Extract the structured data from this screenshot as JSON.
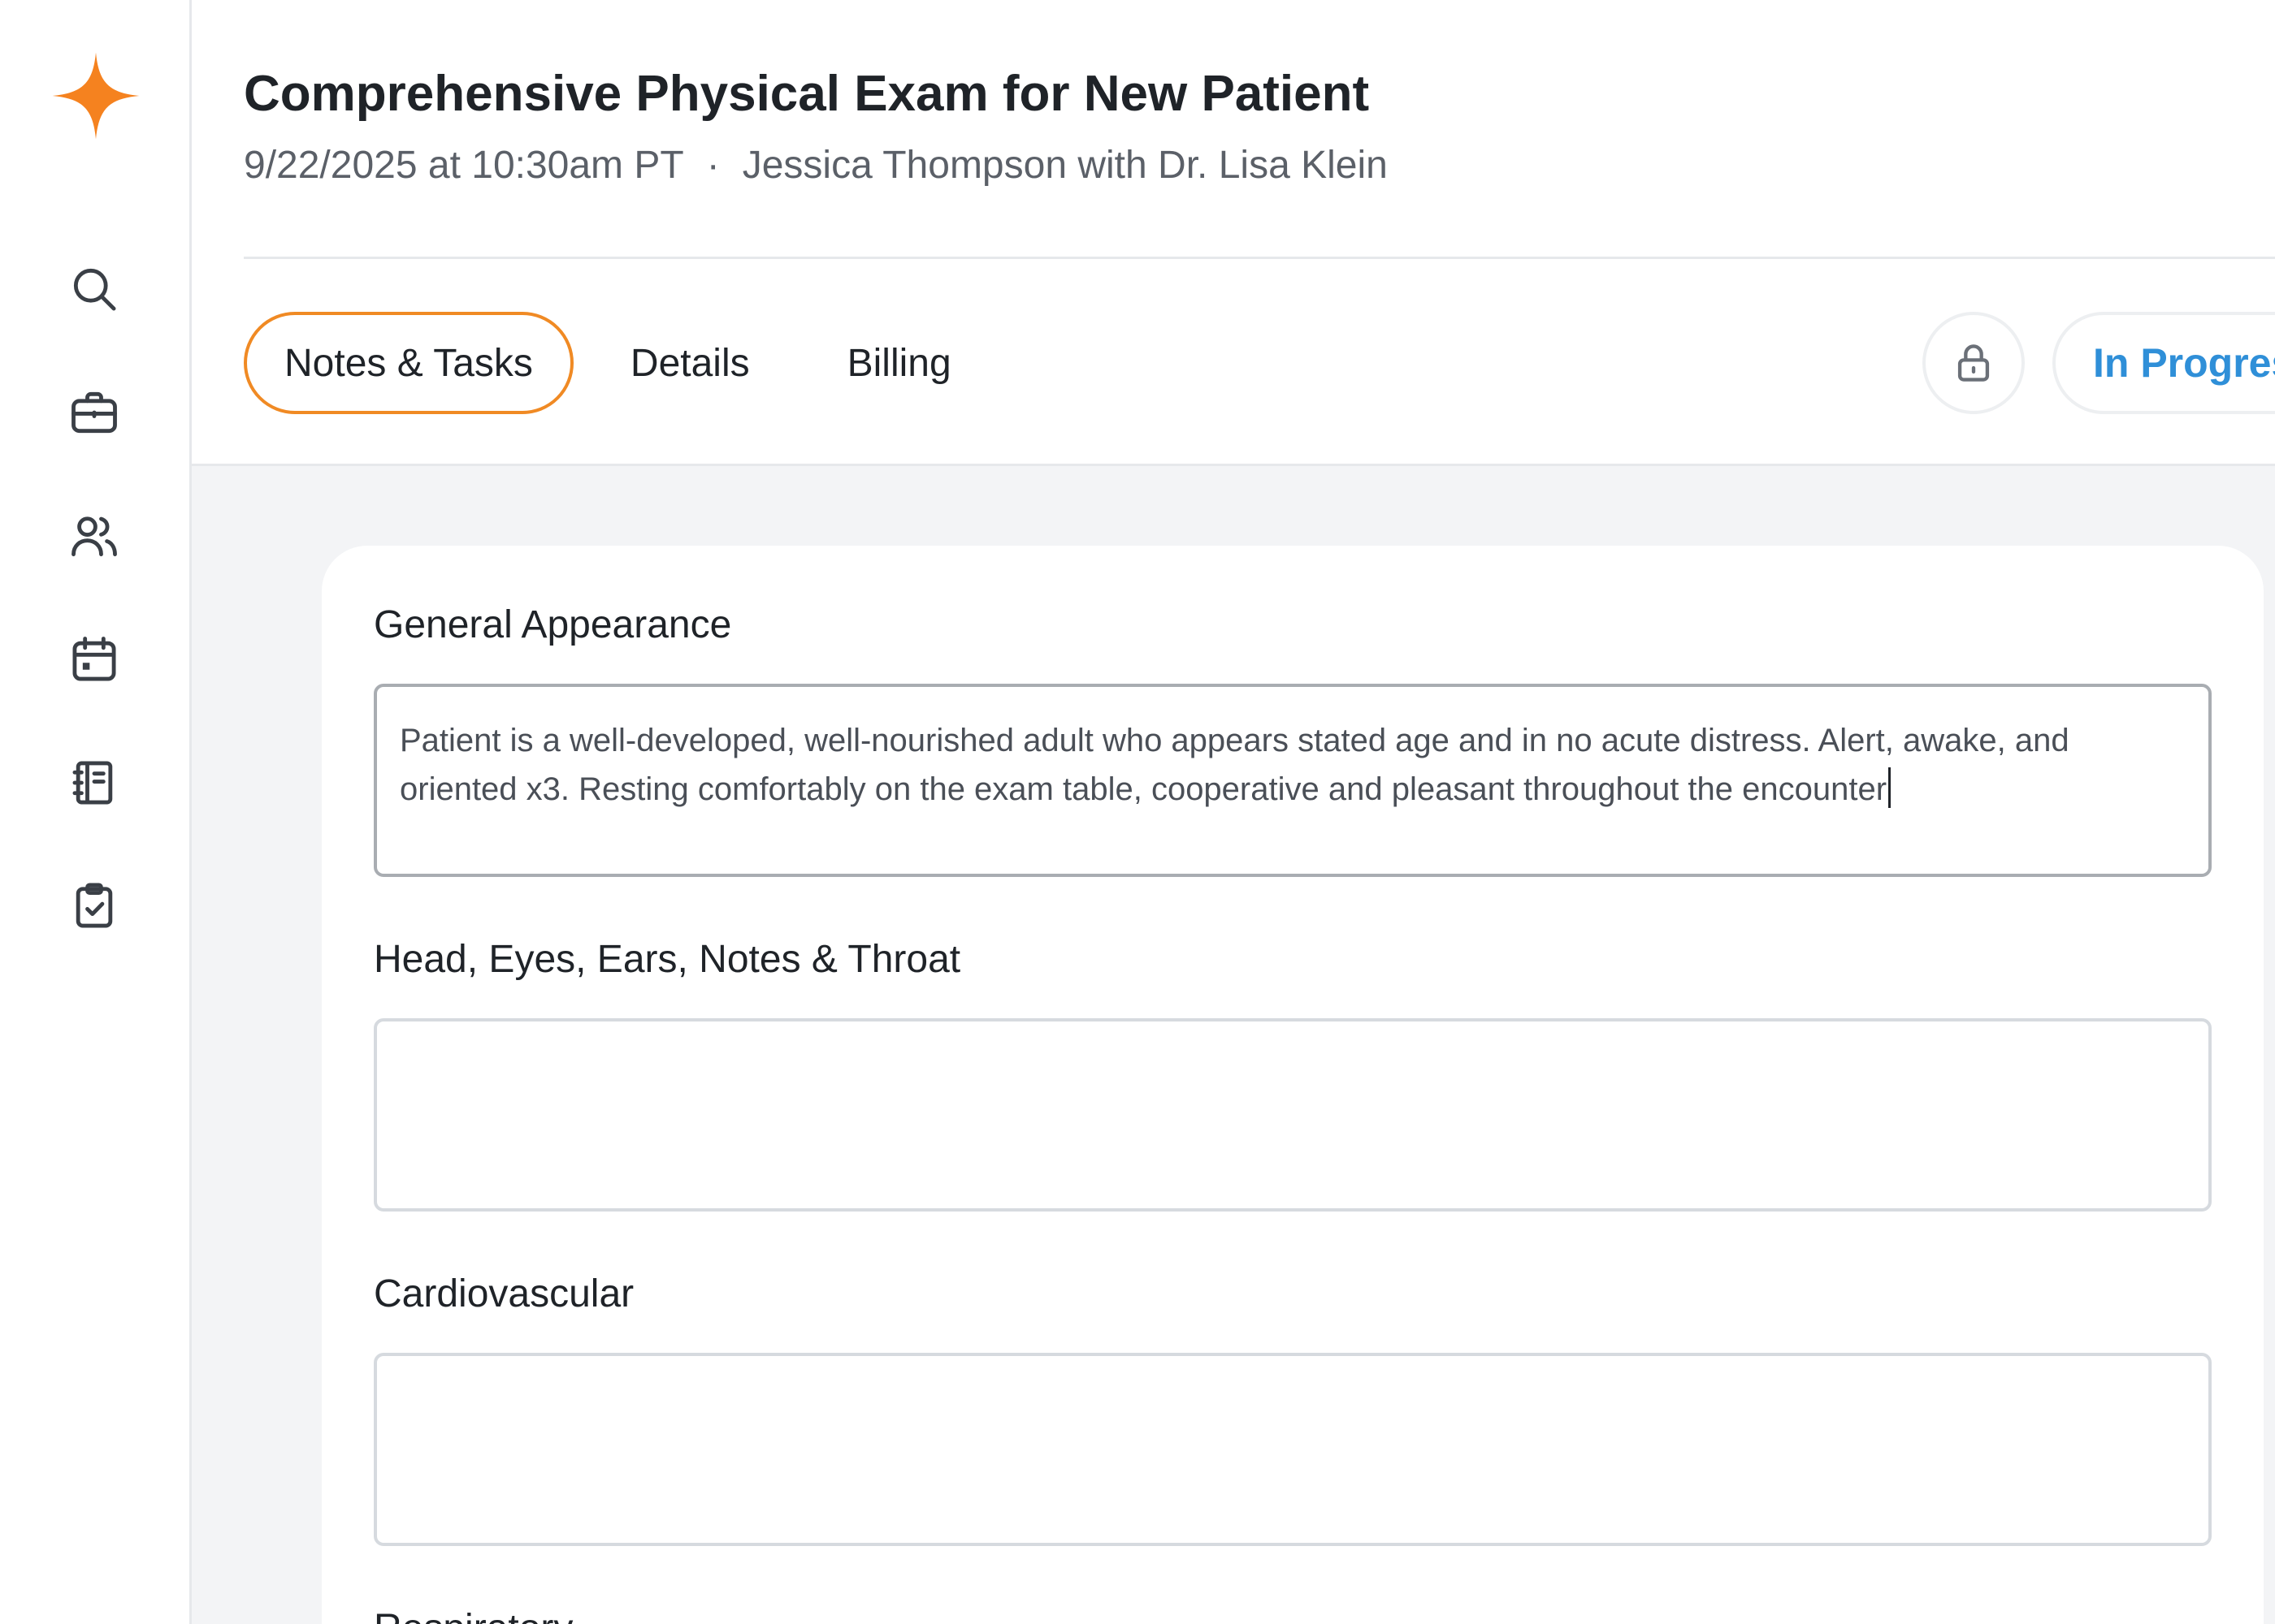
{
  "sidebar": {
    "logo": "sparkle-logo",
    "accent_color": "#f08a24",
    "items": [
      {
        "icon": "search-icon"
      },
      {
        "icon": "briefcase-icon"
      },
      {
        "icon": "users-icon"
      },
      {
        "icon": "calendar-icon"
      },
      {
        "icon": "notebook-icon"
      },
      {
        "icon": "clipboard-check-icon"
      }
    ]
  },
  "header": {
    "title": "Comprehensive Physical Exam for New Patient",
    "datetime": "9/22/2025 at 10:30am PT",
    "separator": "·",
    "participants": "Jessica Thompson with Dr. Lisa Klein"
  },
  "tabs": [
    {
      "label": "Notes & Tasks",
      "active": true
    },
    {
      "label": "Details",
      "active": false
    },
    {
      "label": "Billing",
      "active": false
    }
  ],
  "status": {
    "lock_icon": "lock-icon",
    "label": "In Progress",
    "color": "#2f8fd8"
  },
  "form": {
    "fields": [
      {
        "label": "General Appearance",
        "value": "Patient is a well-developed, well-nourished adult who appears stated age and in no acute distress. Alert, awake, and oriented x3. Resting comfortably on the exam table, cooperative and pleasant throughout the encounter"
      },
      {
        "label": "Head, Eyes, Ears, Notes & Throat",
        "value": ""
      },
      {
        "label": "Cardiovascular",
        "value": ""
      },
      {
        "label": "Respiratory",
        "value": ""
      }
    ]
  }
}
